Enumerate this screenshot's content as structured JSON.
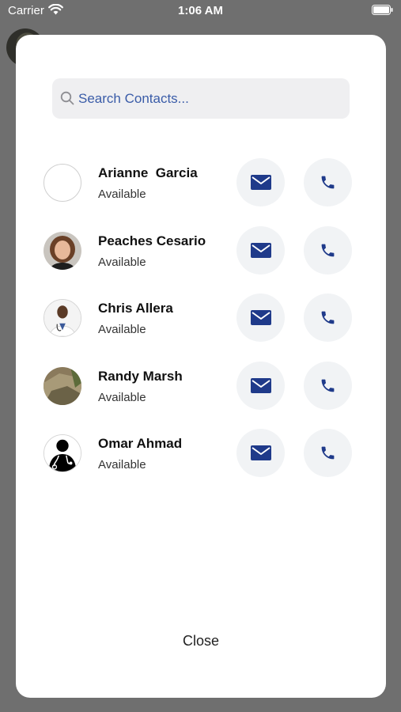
{
  "status_bar": {
    "carrier": "Carrier",
    "time": "1:06 AM"
  },
  "search": {
    "placeholder": "Search Contacts..."
  },
  "contacts": [
    {
      "name": "Arianne  Garcia",
      "status": "Available",
      "avatar": "empty"
    },
    {
      "name": "Peaches Cesario",
      "status": "Available",
      "avatar": "woman-photo"
    },
    {
      "name": "Chris Allera",
      "status": "Available",
      "avatar": "doctor-photo"
    },
    {
      "name": "Randy Marsh",
      "status": "Available",
      "avatar": "landscape-photo"
    },
    {
      "name": "Omar Ahmad",
      "status": "Available",
      "avatar": "doctor-silhouette-icon"
    }
  ],
  "actions": {
    "mail_icon": "envelope-icon",
    "phone_icon": "phone-icon"
  },
  "footer": {
    "close_label": "Close"
  },
  "colors": {
    "accent": "#1f3a8a",
    "button_bg": "#f1f3f5",
    "search_bg": "#efeff1",
    "placeholder": "#3a5ca8"
  }
}
